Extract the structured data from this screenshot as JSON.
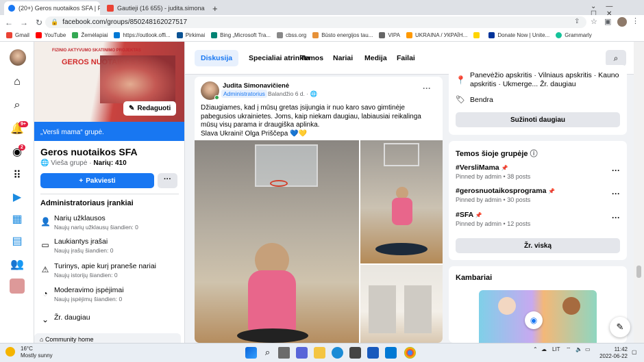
{
  "browser": {
    "tabs": [
      {
        "title": "(20+) Geros nuotaikos SFA | Face",
        "color": "#1877f2"
      },
      {
        "title": "Gautieji (16 655) - judita.simona",
        "color": "#ea4335"
      }
    ],
    "new_tab": "+",
    "url": "facebook.com/groups/850248162027517",
    "bookmarks": [
      {
        "label": "Gmail",
        "color": "#ea4335"
      },
      {
        "label": "YouTube",
        "color": "#ff0000"
      },
      {
        "label": "Žemėlapiai",
        "color": "#34a853"
      },
      {
        "label": "https://outlook.offi...",
        "color": "#0078d4"
      },
      {
        "label": "Pirkimai",
        "color": "#0b5394"
      },
      {
        "label": "Bing „Microsoft Tra...",
        "color": "#008373"
      },
      {
        "label": "cbss.org",
        "color": "#888888"
      },
      {
        "label": "Būsto energijos tau...",
        "color": "#e69138"
      },
      {
        "label": "VIPA",
        "color": "#666666"
      },
      {
        "label": "UKRAINA / УКРАЇН...",
        "color": "#ff9900"
      },
      {
        "label": "",
        "color": "#ffd500"
      },
      {
        "label": "Donate Now | Unite...",
        "color": "#003399"
      },
      {
        "label": "Grammarly",
        "color": "#15c39a"
      }
    ]
  },
  "rail": {
    "badge_notifications": "9+",
    "badge_messenger": "2"
  },
  "group": {
    "cover_title": "FIZINIO AKTYVUMO SKATINIMO PROJEKTAS",
    "cover_logo": "GEROS NUOTAIKOS SFA",
    "edit_label": "Redaguoti",
    "banner": "„Versli mama“ grupė.",
    "name": "Geros nuotaikos SFA",
    "privacy": "Vieša grupė",
    "members": "Narių: 410",
    "join_label": "Pakviesti",
    "more_label": "···",
    "admin_tools_title": "Administratoriaus įrankiai",
    "admin_tools": [
      {
        "title": "Narių užklausos",
        "subtitle": "Naujų narių užklausų šiandien: 0"
      },
      {
        "title": "Laukiantys įrašai",
        "subtitle": "Naujų įrašų šiandien: 0"
      },
      {
        "title": "Turinys, apie kurį praneše nariai",
        "subtitle": "Naujų istorijų šiandien: 0"
      },
      {
        "title": "Moderavimo įspėjimai",
        "subtitle": "Naujų įspėjimų šiandien: 0"
      }
    ],
    "see_more": "Žr. daugiau",
    "community_home": "Community home"
  },
  "tabs": [
    "Diskusija",
    "Specialiai atrinkta",
    "Temos",
    "Nariai",
    "Medija",
    "Failai"
  ],
  "post": {
    "author": "Judita Simonavičienė",
    "role": "Administratorius",
    "date": "Balandžio 6 d. ·",
    "text": "Džiaugiames,  kad į mūsų gretas įsijungia ir nuo karo savo gimtinėje pabegusios ukrainietes.  Joms,  kaip niekam daugiau, labiausiai reikalinga mūsų visų parama ir draugiška aplinka.",
    "text2": "Slava Ukraini!  Olga Priščepa 💙💛"
  },
  "about": {
    "location": "Panevėžio apskritis · Vilniaus apskritis · Kauno apskritis · Ukmerge... Žr. daugiau",
    "general": "Bendra",
    "learn_more": "Sužinoti daugiau"
  },
  "topics": {
    "title": "Temos šioje grupėje",
    "items": [
      {
        "tag": "#VersliMama",
        "sub": "Pinned by admin • 38 posts"
      },
      {
        "tag": "#gerosnuotaikosprograma",
        "sub": "Pinned by admin • 30 posts"
      },
      {
        "tag": "#SFA",
        "sub": "Pinned by admin • 12 posts"
      }
    ],
    "see_all": "Žr. viską"
  },
  "rooms": {
    "title": "Kambariai"
  },
  "taskbar": {
    "temp": "16°C",
    "weather": "Mostly sunny",
    "lang": "LIT",
    "time": "11:42",
    "date": "2022-06-22"
  }
}
